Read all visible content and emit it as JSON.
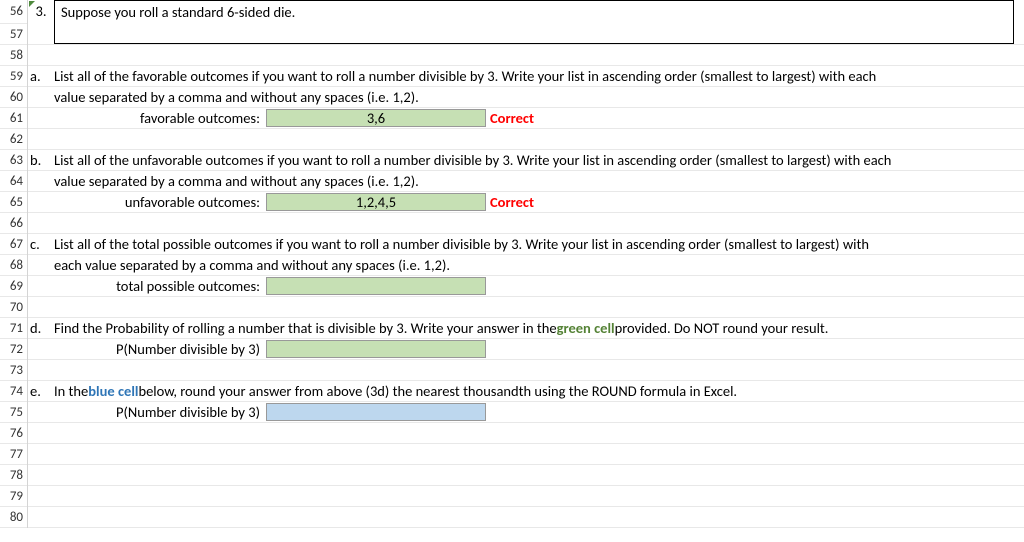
{
  "rows": [
    "56",
    "57",
    "58",
    "59",
    "60",
    "61",
    "62",
    "63",
    "64",
    "65",
    "66",
    "67",
    "68",
    "69",
    "70",
    "71",
    "72",
    "73",
    "74",
    "75",
    "76",
    "77",
    "78",
    "79",
    "80"
  ],
  "question": {
    "number": "3.",
    "title": "Suppose you roll a standard 6-sided die."
  },
  "parts": {
    "a": {
      "letter": "a.",
      "line1": "List all of the favorable outcomes if you want to roll a number divisible by 3. Write your list in ascending order (smallest to largest) with each",
      "line2": "value separated by a comma and without any spaces (i.e. 1,2).",
      "label": "favorable outcomes:",
      "value": "3,6",
      "status": "Correct"
    },
    "b": {
      "letter": "b.",
      "line1": "List all of the unfavorable outcomes if you want to roll a number divisible by 3. Write your list in ascending order (smallest to largest) with each",
      "line2": "value separated by a comma and without any spaces (i.e. 1,2).",
      "label": "unfavorable outcomes:",
      "value": "1,2,4,5",
      "status": "Correct"
    },
    "c": {
      "letter": "c.",
      "line1": "List all of the total possible outcomes if you want to roll a number divisible by 3. Write your list in ascending order (smallest to largest) with",
      "line2": "each value separated by a comma and without any spaces (i.e. 1,2).",
      "label": "total possible outcomes:",
      "value": ""
    },
    "d": {
      "letter": "d.",
      "line1_pre": "Find the Probability of rolling a number that is divisible by 3. Write your answer in the ",
      "line1_green": "green cell",
      "line1_post": " provided. Do NOT round your result.",
      "label": "P(Number divisible by 3)",
      "value": ""
    },
    "e": {
      "letter": "e.",
      "line1_pre": "In the ",
      "line1_blue": "blue cell",
      "line1_post": " below, round your answer from above (3d) the nearest thousandth using the ROUND formula in Excel.",
      "label": "P(Number divisible by 3)",
      "value": ""
    }
  }
}
